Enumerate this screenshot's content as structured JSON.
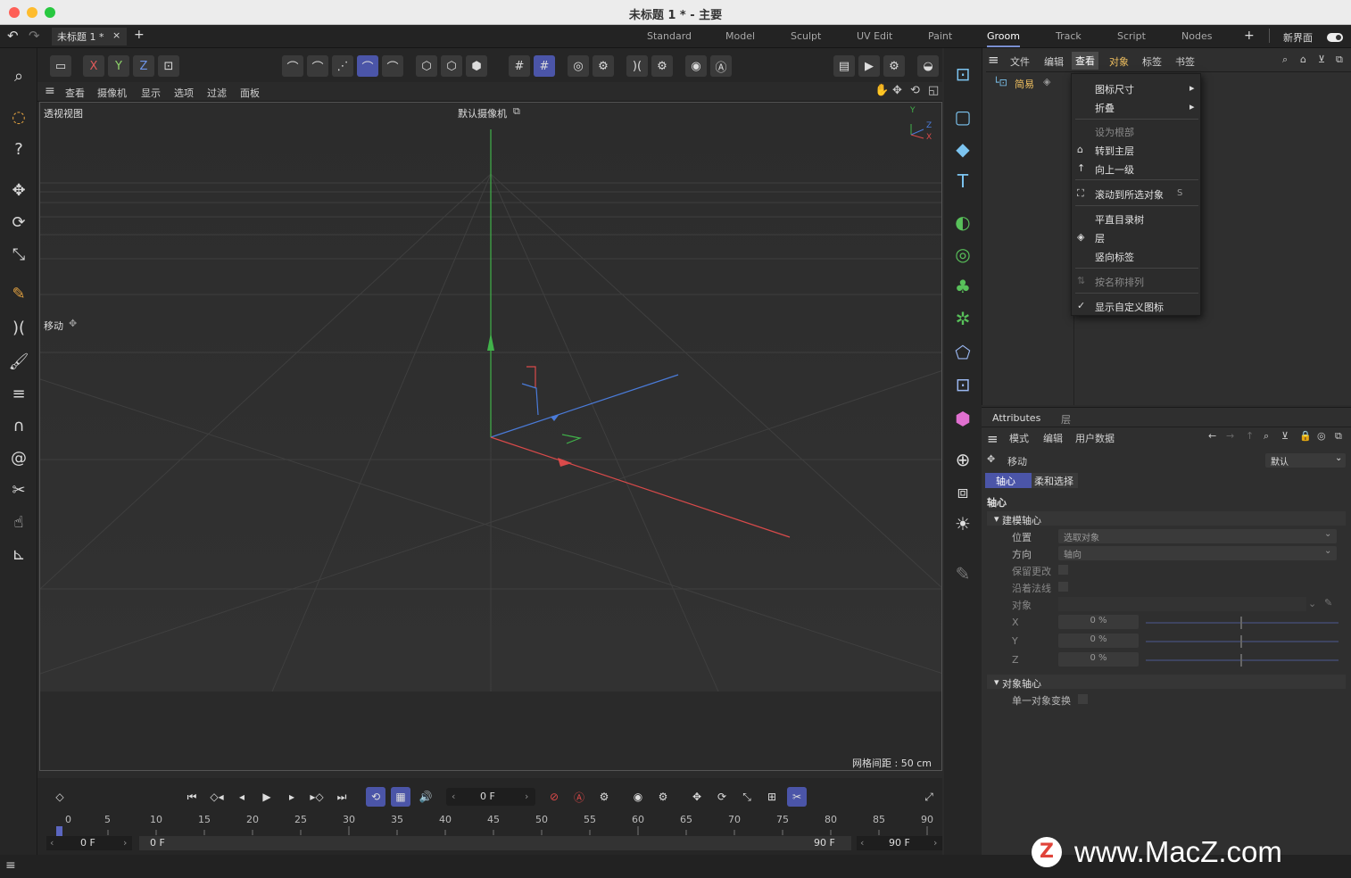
{
  "window": {
    "title": "未标题 1 * - 主要"
  },
  "doc_tab": {
    "label": "未标题 1 *",
    "close": "×",
    "add": "+"
  },
  "layouts": [
    "Standard",
    "Model",
    "Sculpt",
    "UV Edit",
    "Paint",
    "Groom",
    "Track",
    "Script",
    "Nodes"
  ],
  "layouts_active": "Groom",
  "layouts_add": "+",
  "new_ui_label": "新界面",
  "axis_buttons": {
    "x": "X",
    "y": "Y",
    "z": "Z"
  },
  "viewport": {
    "menu": [
      "查看",
      "摄像机",
      "显示",
      "选项",
      "过滤",
      "面板"
    ],
    "view_name": "透视视图",
    "camera": "默认摄像机",
    "tool_label": "移动",
    "grid_spacing": "网格间距 : 50 cm",
    "gizmo_axes": {
      "y": "Y",
      "z": "Z",
      "x": "X"
    }
  },
  "object_panel": {
    "menu": [
      "文件",
      "编辑",
      "查看",
      "对象",
      "标签",
      "书签"
    ],
    "active_menu": "查看",
    "tree_item": "简易"
  },
  "dropdown": {
    "items": [
      {
        "label": "图标尺寸",
        "submenu": "▸",
        "icon": "",
        "shortcut": "",
        "disabled": false
      },
      {
        "label": "折叠",
        "submenu": "▸",
        "icon": "",
        "shortcut": "",
        "disabled": false
      },
      {
        "label": "设为根部",
        "submenu": "",
        "icon": "",
        "shortcut": "",
        "disabled": true
      },
      {
        "label": "转到主层",
        "submenu": "",
        "icon": "home-icon",
        "shortcut": "",
        "disabled": false
      },
      {
        "label": "向上一级",
        "submenu": "",
        "icon": "arrow-up-icon",
        "shortcut": "",
        "disabled": false
      },
      {
        "label": "滚动到所选对象",
        "submenu": "",
        "icon": "scroll-to-icon",
        "shortcut": "S",
        "disabled": false
      },
      {
        "label": "平直目录树",
        "submenu": "",
        "icon": "",
        "shortcut": "",
        "disabled": false
      },
      {
        "label": "层",
        "submenu": "",
        "icon": "layers-icon",
        "shortcut": "",
        "disabled": false
      },
      {
        "label": "竖向标签",
        "submenu": "",
        "icon": "",
        "shortcut": "",
        "disabled": false
      },
      {
        "label": "按名称排列",
        "submenu": "",
        "icon": "sort-icon",
        "shortcut": "",
        "disabled": true
      },
      {
        "label": "显示自定义图标",
        "submenu": "",
        "icon": "check-icon",
        "shortcut": "",
        "disabled": false
      }
    ]
  },
  "attributes": {
    "tabs": [
      "Attributes",
      "层"
    ],
    "menu": [
      "模式",
      "编辑",
      "用户数据"
    ],
    "tool_name": "移动",
    "preset": "默认",
    "subtabs": [
      "轴心",
      "柔和选择"
    ],
    "section": "轴心",
    "group1": "建模轴心",
    "position_label": "位置",
    "position_value": "选取对象",
    "direction_label": "方向",
    "direction_value": "轴向",
    "keep_changes_label": "保留更改",
    "along_normal_label": "沿着法线",
    "object_label": "对象",
    "x_label": "X",
    "x_value": "0 %",
    "y_label": "Y",
    "y_value": "0 %",
    "z_label": "Z",
    "z_value": "0 %",
    "group2": "对象轴心",
    "single_object_label": "单一对象变换"
  },
  "timeline": {
    "current_frame": "0 F",
    "ticks": [
      "0",
      "5",
      "10",
      "15",
      "20",
      "25",
      "30",
      "35",
      "40",
      "45",
      "50",
      "55",
      "60",
      "65",
      "70",
      "75",
      "80",
      "85",
      "90"
    ],
    "start": "0 F",
    "range_start": "0 F",
    "range_end": "90 F",
    "end": "90 F"
  },
  "watermark": "www.MacZ.com",
  "colors": {
    "accent": "#4b55a8",
    "x_axis": "#d94a4a",
    "y_axis": "#58c15a",
    "z_axis": "#4a7bd9"
  }
}
